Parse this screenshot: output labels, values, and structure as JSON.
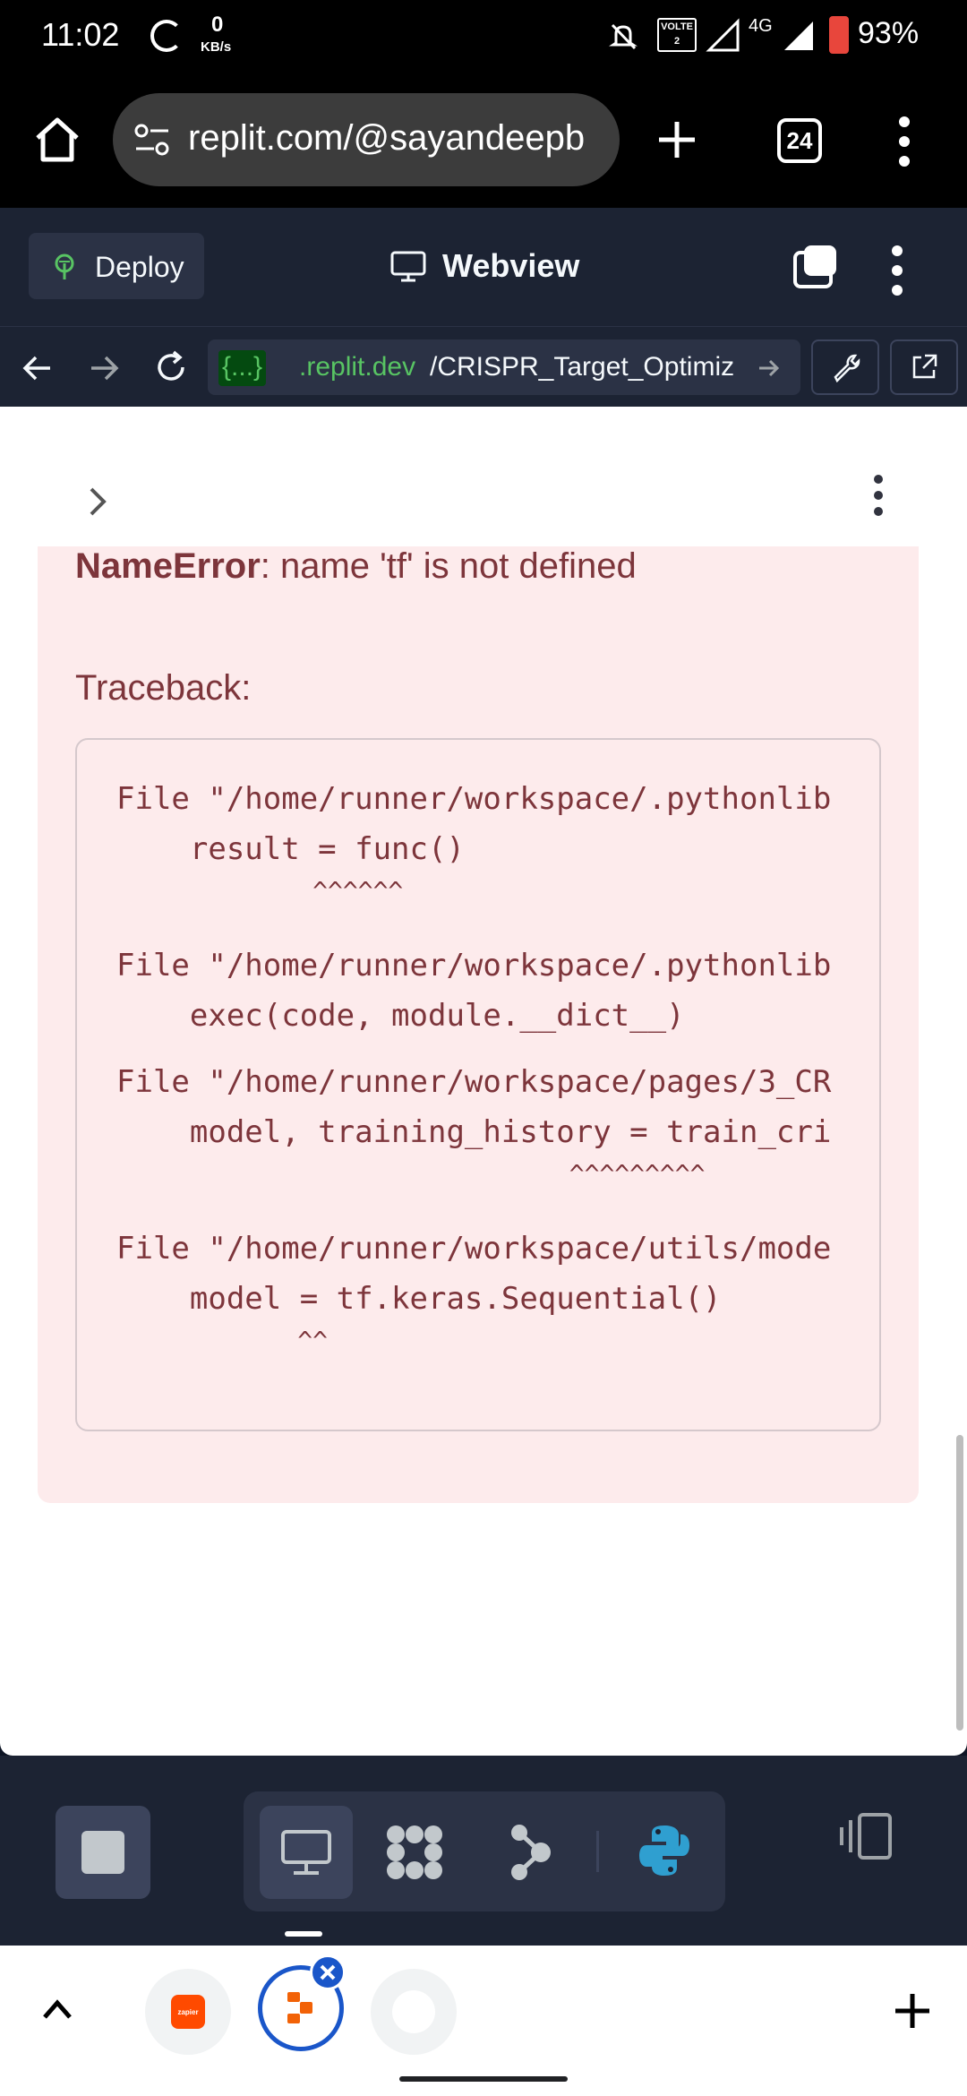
{
  "status": {
    "time": "11:02",
    "net_speed": "0",
    "net_unit": "KB/s",
    "volte": "VOLTE",
    "sim": "2",
    "net_type": "4G",
    "battery": "93%"
  },
  "browser": {
    "url": "replit.com/@sayandeepb",
    "tab_count": "24"
  },
  "replit_header": {
    "deploy_label": "Deploy",
    "webview_label": "Webview"
  },
  "webview_nav": {
    "domain_tag": "{...}",
    "domain": ".replit.dev",
    "path": "/CRISPR_Target_Optimiz"
  },
  "error": {
    "name": "NameError",
    "message": ": name 'tf' is not defined",
    "traceback_label": "Traceback:",
    "lines": [
      "File \"/home/runner/workspace/.pythonlib",
      "    result = func()",
      "             ^^^^^^",
      "File \"/home/runner/workspace/.pythonlib",
      "    exec(code, module.__dict__)",
      "File \"/home/runner/workspace/pages/3_CR",
      "    model, training_history = train_cri",
      "                              ^^^^^^^^^",
      "File \"/home/runner/workspace/utils/mode",
      "    model = tf.keras.Sequential()",
      "            ^^"
    ]
  },
  "bottom_tabs": {
    "zapier_label": "zapier"
  },
  "colors": {
    "error_bg": "#fdebec",
    "error_text": "#7d353b",
    "replit_bg": "#1c2333",
    "domain_green": "#58c463",
    "python_blue": "#2f9fd0"
  }
}
